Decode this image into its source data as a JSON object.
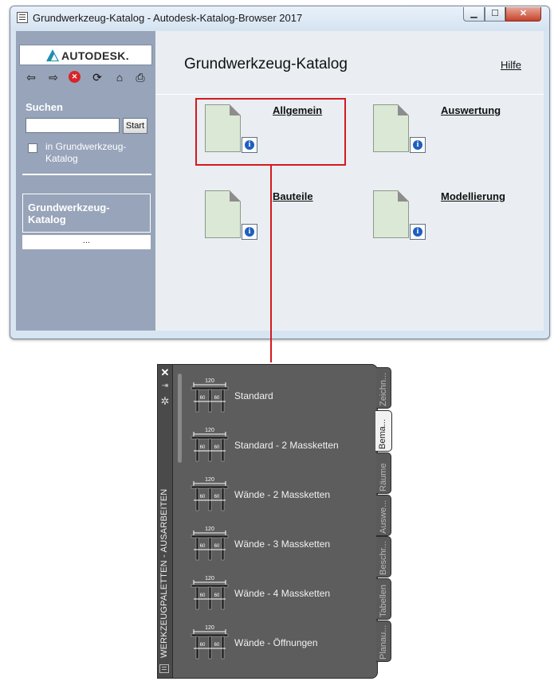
{
  "window": {
    "title": "Grundwerkzeug-Katalog - Autodesk-Katalog-Browser 2017",
    "controls": {
      "minimize": "▁",
      "maximize": "☐",
      "close": "✕"
    }
  },
  "sidebar": {
    "logo_text": "AUTODESK.",
    "toolbar": {
      "back": "⇦",
      "forward": "⇨",
      "stop": "✕",
      "refresh": "⟳",
      "home": "⌂",
      "print": "⎙"
    },
    "search_label": "Suchen",
    "search_value": "",
    "start_label": "Start",
    "scope_checkbox_label": "in Grundwerkzeug-Katalog",
    "nav_item_label": "Grundwerkzeug-Katalog",
    "nav_more_label": "..."
  },
  "main": {
    "title": "Grundwerkzeug-Katalog",
    "help_label": "Hilfe",
    "info_glyph": "i",
    "categories": [
      {
        "label": "Allgemein"
      },
      {
        "label": "Auswertung"
      },
      {
        "label": "Bauteile"
      },
      {
        "label": "Modellierung"
      }
    ]
  },
  "palette": {
    "title": "WERKZEUGPALETTEN - AUSARBEITEN",
    "controls": {
      "close": "✕",
      "autohide": "⇥",
      "properties": "✲"
    },
    "icon_label": "120",
    "items": [
      {
        "label": "Standard"
      },
      {
        "label": "Standard - 2 Massketten"
      },
      {
        "label": "Wände - 2 Massketten"
      },
      {
        "label": "Wände - 3 Massketten"
      },
      {
        "label": "Wände - 4 Massketten"
      },
      {
        "label": "Wände - Öffnungen"
      }
    ],
    "tabs": [
      {
        "label": "Zeichn..."
      },
      {
        "label": "Bema..."
      },
      {
        "label": "Räume"
      },
      {
        "label": "Auswe..."
      },
      {
        "label": "Beschr..."
      },
      {
        "label": "Tabellen"
      },
      {
        "label": "Planau..."
      }
    ],
    "active_tab": "Bema..."
  }
}
